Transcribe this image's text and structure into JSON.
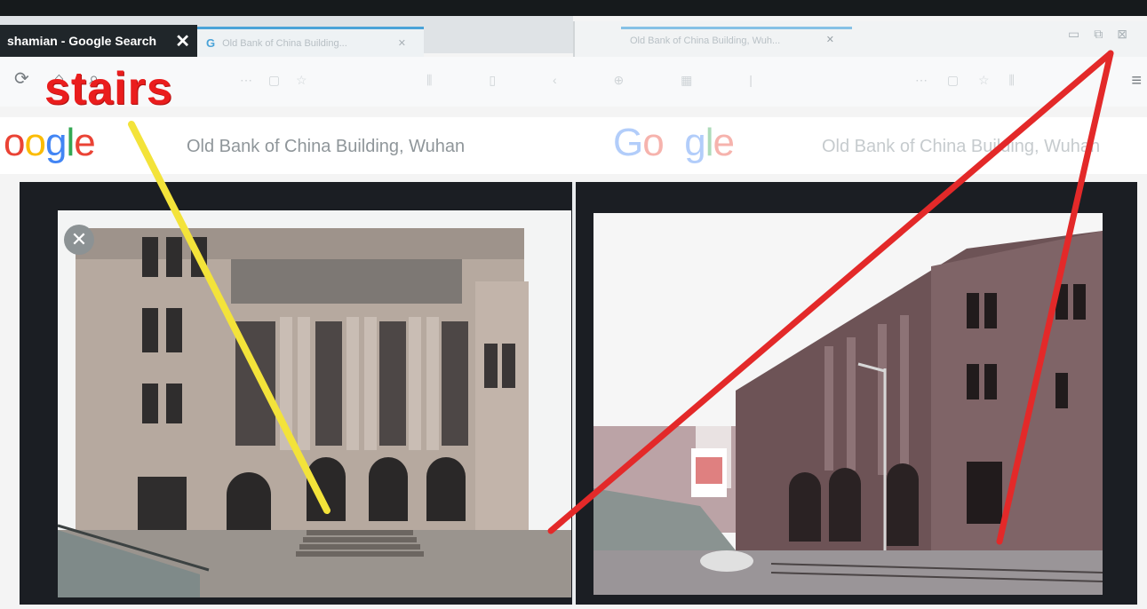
{
  "left_window": {
    "tab_active_title": "shamian - Google Search",
    "tab_inactive_title": "Old Bank of China Building...",
    "search_query": "Old Bank of China Building, Wuhan"
  },
  "right_window": {
    "tab_title": "Old Bank of China Building, Wuh...",
    "search_query": "Old Bank of China Building, Wuhan"
  },
  "logo_text": {
    "left": "oogle",
    "right": "Google"
  },
  "annotation": {
    "label": "stairs",
    "colors": {
      "label": "#ea1d1d",
      "yellow_line": "#f3e33a",
      "red_lines": "#e32929"
    }
  },
  "icons": {
    "close_active_tab": "close-icon",
    "close_inactive_tab": "close-icon",
    "reload": "reload-icon",
    "home": "home-icon",
    "star": "star-icon",
    "menu": "menu-icon",
    "image_close": "close-icon"
  }
}
